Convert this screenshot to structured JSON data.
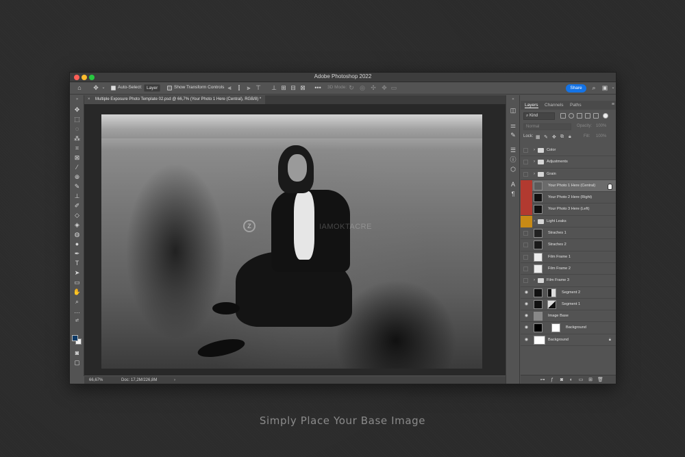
{
  "app": {
    "title": "Adobe Photoshop 2022"
  },
  "options_bar": {
    "auto_select_label": "Auto-Select:",
    "auto_select_value": "Layer",
    "transform_label": "Show Transform Controls",
    "mode_label": "3D Mode:",
    "share_label": "Share"
  },
  "document": {
    "tab_title": "Multiple Exposure Photo Template 02.psd @ 66,7% (Your Photo 1 Here (Central), RGB/8) *",
    "watermark": "IAMOKTACRE"
  },
  "status": {
    "zoom": "66,67%",
    "doc": "Doc: 17,2M/226,8M"
  },
  "panel": {
    "tabs": [
      "Layers",
      "Channels",
      "Paths"
    ],
    "kind_label": "Kind",
    "blend_mode": "Normal",
    "opacity_label": "Opacity:",
    "opacity_value": "100%",
    "lock_label": "Lock:",
    "fill_label": "Fill:",
    "fill_value": "100%",
    "layers": [
      {
        "name": "Color",
        "type": "group",
        "tag": "none",
        "visible": false
      },
      {
        "name": "Adjustments",
        "type": "group",
        "tag": "none",
        "visible": false
      },
      {
        "name": "Grain",
        "type": "group",
        "tag": "none",
        "visible": false
      },
      {
        "name": "Your Photo 1 Here (Central)",
        "type": "smart",
        "tag": "#c0392b",
        "visible": false,
        "selected": true
      },
      {
        "name": "Your Photo 2 Here (Right)",
        "type": "smart",
        "tag": "#c0392b",
        "visible": false
      },
      {
        "name": "Your Photo 3 Here (Left)",
        "type": "smart",
        "tag": "#c0392b",
        "visible": false
      },
      {
        "name": "Light Leaks",
        "type": "group",
        "tag": "#c98a1a",
        "visible": false
      },
      {
        "name": "Straches 1",
        "type": "layer",
        "tag": "none",
        "visible": false
      },
      {
        "name": "Straches 2",
        "type": "layer",
        "tag": "none",
        "visible": false
      },
      {
        "name": "Film Frame 1",
        "type": "layer",
        "tag": "none",
        "visible": false
      },
      {
        "name": "Film Frame 2",
        "type": "layer",
        "tag": "none",
        "visible": false
      },
      {
        "name": "Film Frame 3",
        "type": "group",
        "tag": "none",
        "visible": false
      },
      {
        "name": "Segment 2",
        "type": "masked",
        "tag": "none",
        "visible": true
      },
      {
        "name": "Segment 1",
        "type": "masked",
        "tag": "none",
        "visible": true
      },
      {
        "name": "Image Base",
        "type": "smart",
        "tag": "none",
        "visible": true
      },
      {
        "name": "Background",
        "type": "masked-white",
        "tag": "none",
        "visible": true
      },
      {
        "name": "Background",
        "type": "bg",
        "tag": "none",
        "visible": true,
        "locked": true
      }
    ]
  },
  "caption": "Simply Place Your Base Image"
}
